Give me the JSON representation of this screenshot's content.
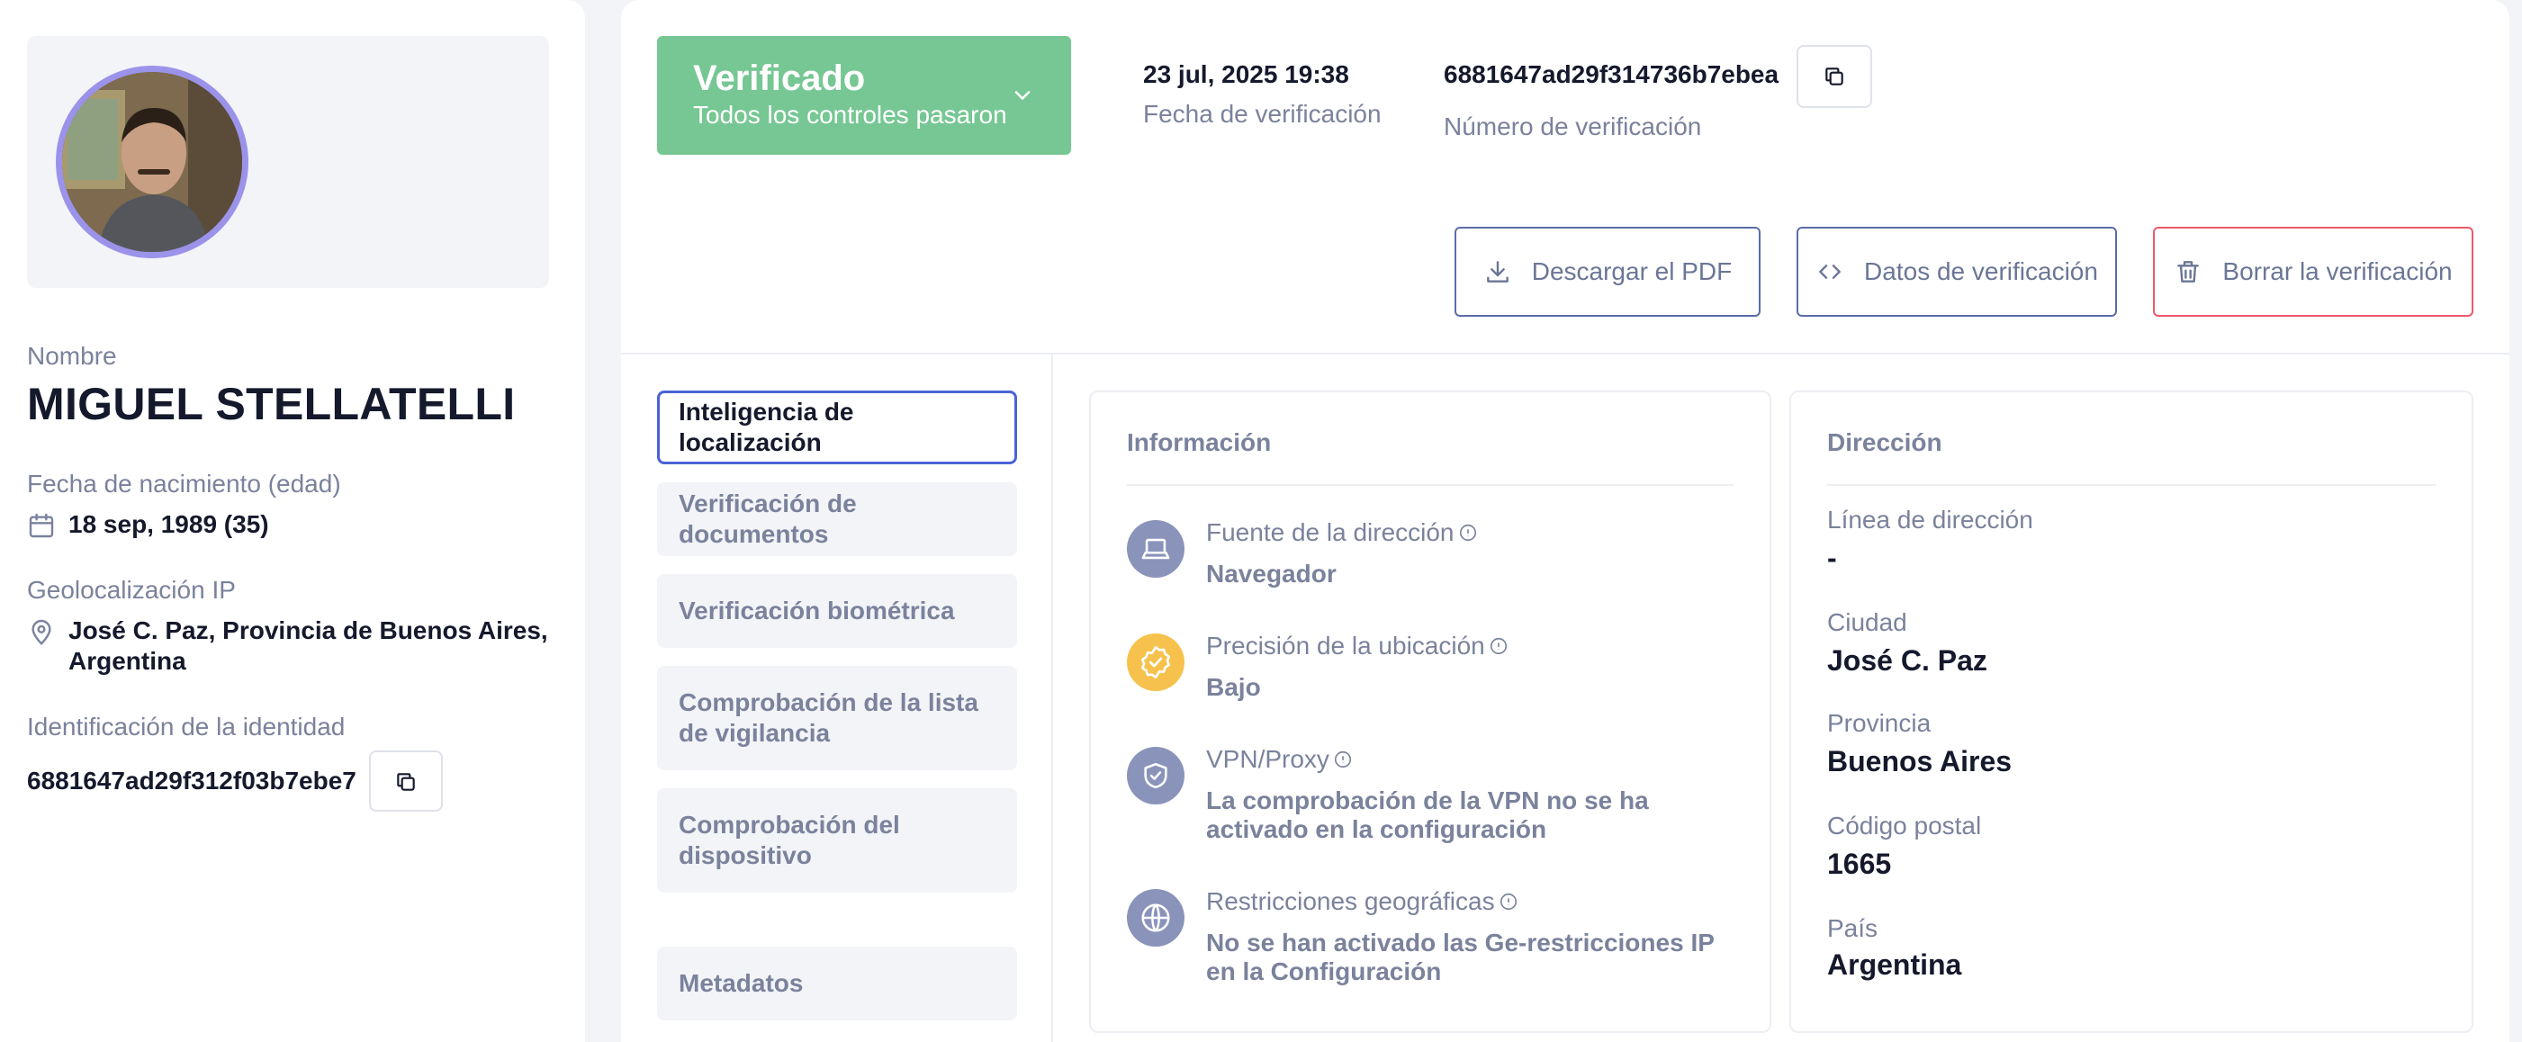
{
  "profile": {
    "name_label": "Nombre",
    "name": "MIGUEL STELLATELLI",
    "dob_label": "Fecha de nacimiento (edad)",
    "dob": "18 sep, 1989 (35)",
    "geo_label": "Geolocalización IP",
    "geo_line1": "José C. Paz, Provincia de Buenos Aires,",
    "geo_line2": "Argentina",
    "id_label": "Identificación de la identidad",
    "id_value": "6881647ad29f312f03b7ebe7"
  },
  "header": {
    "status_title": "Verificado",
    "status_subtitle": "Todos los controles pasaron",
    "date_value": "23 jul, 2025 19:38",
    "date_label": "Fecha de verificación",
    "number_value": "6881647ad29f314736b7ebea",
    "number_label": "Número de verificación",
    "status_color": "#76c793"
  },
  "actions": {
    "download": "Descargar el PDF",
    "data": "Datos de verificación",
    "delete": "Borrar la verificación"
  },
  "nav": {
    "items": [
      {
        "label": "Inteligencia de localización"
      },
      {
        "label": "Verificación de documentos"
      },
      {
        "label": "Verificación biométrica"
      },
      {
        "label": "Comprobación de la lista de vigilancia"
      },
      {
        "label": "Comprobación del dispositivo"
      },
      {
        "label": "Metadatos"
      }
    ],
    "active": 0
  },
  "info": {
    "title": "Información",
    "rows": [
      {
        "label": "Fuente de la dirección",
        "value": "Navegador",
        "icon": "laptop-icon"
      },
      {
        "label": "Precisión de la ubicación",
        "value": "Bajo",
        "icon": "badge-check-icon"
      },
      {
        "label": "VPN/Proxy",
        "value": "La comprobación de la VPN no se ha activado en la configuración",
        "icon": "shield-check-icon"
      },
      {
        "label": "Restricciones geográficas",
        "value": "No se han activado las Ge-restricciones IP en la Configuración",
        "icon": "globe-icon"
      }
    ]
  },
  "address": {
    "title": "Dirección",
    "line_label": "Línea de dirección",
    "line_value": "-",
    "city_label": "Ciudad",
    "city_value": "José C. Paz",
    "province_label": "Provincia",
    "province_value": "Buenos Aires",
    "zip_label": "Código postal",
    "zip_value": "1665",
    "country_label": "País",
    "country_value": "Argentina"
  }
}
